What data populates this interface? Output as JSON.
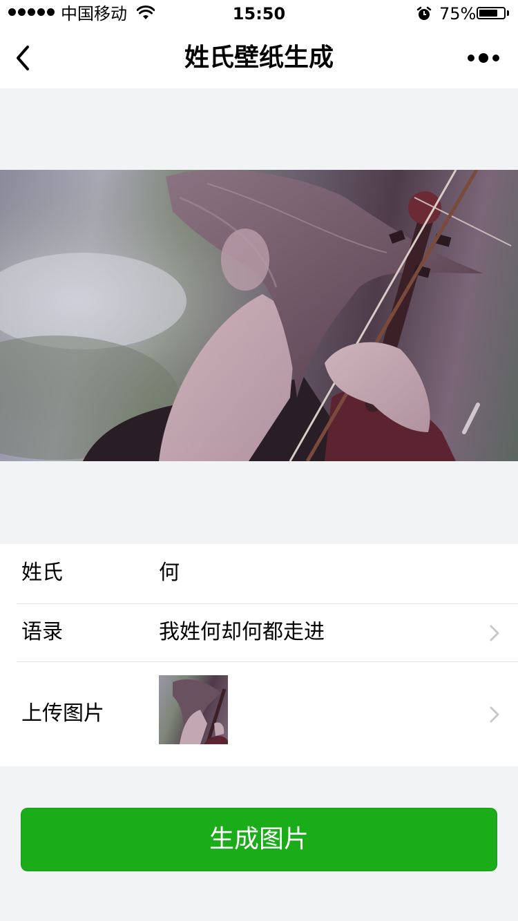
{
  "status_bar": {
    "carrier": "中国移动",
    "time": "15:50",
    "battery": "75%",
    "battery_level": 0.75,
    "icons": [
      "signal-dots-icon",
      "wifi-icon",
      "alarm-icon",
      "battery-icon"
    ]
  },
  "nav": {
    "title": "姓氏壁纸生成",
    "icons": [
      "back-chevron-icon",
      "more-dots-icon"
    ]
  },
  "form": {
    "surname": {
      "label": "姓氏",
      "value": "何"
    },
    "quote": {
      "label": "语录",
      "value": "我姓何却何都走进"
    },
    "upload": {
      "label": "上传图片"
    }
  },
  "actions": {
    "generate_label": "生成图片"
  },
  "colors": {
    "page_bg": "#f2f3f5",
    "accent_green": "#1aad19",
    "divider": "#e3e3e6",
    "chevron": "#c7c7cc"
  }
}
